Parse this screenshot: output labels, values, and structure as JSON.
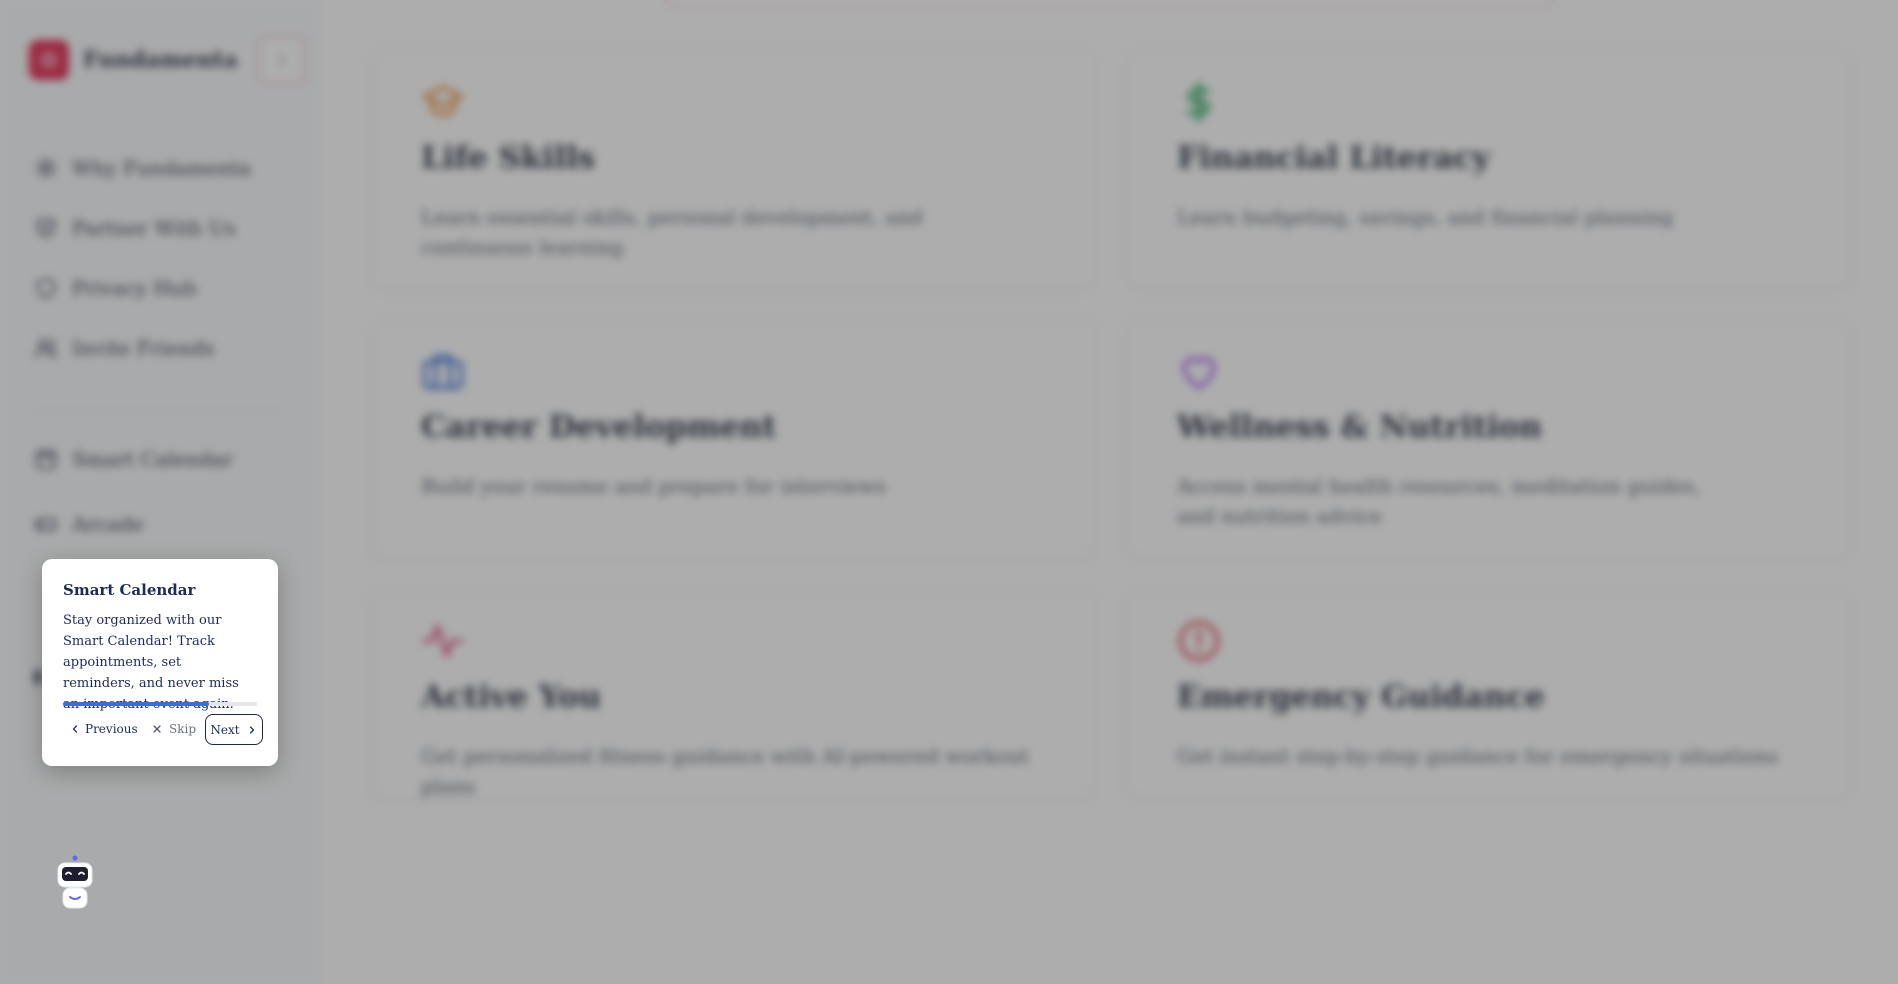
{
  "app": {
    "name": "Fundamenta",
    "brand_color": "#e11d48"
  },
  "sidebar": {
    "collapse_icon": "chevron-left-icon",
    "items": [
      {
        "label": "Why Fundamenta",
        "icon": "sparkle-cog-icon"
      },
      {
        "label": "Partner With Us",
        "icon": "handshake-shield-icon"
      },
      {
        "label": "Privacy Hub",
        "icon": "shield-icon"
      },
      {
        "label": "Invite Friends",
        "icon": "users-icon"
      },
      {
        "label": "Smart Calendar",
        "icon": "calendar-icon"
      },
      {
        "label": "Arcade",
        "icon": "gamepad-icon"
      }
    ]
  },
  "cards": [
    {
      "title": "Life Skills",
      "description": "Learn essential skills, personal development, and continuous learning",
      "icon": "graduation-cap-icon",
      "color": "#ea8a2e"
    },
    {
      "title": "Financial Literacy",
      "description": "Learn budgeting, savings, and financial planning",
      "icon": "dollar-icon",
      "color": "#22a55a"
    },
    {
      "title": "Career Development",
      "description": "Build your resume and prepare for interviews",
      "icon": "briefcase-icon",
      "color": "#3b6fd8"
    },
    {
      "title": "Wellness & Nutrition",
      "description": "Access mental health resources, meditation guides, and nutrition advice",
      "icon": "heart-icon",
      "color": "#a855f7"
    },
    {
      "title": "Active You",
      "description": "Get personalized fitness guidance with AI-powered workout plans",
      "icon": "activity-icon",
      "color": "#e0457b"
    },
    {
      "title": "Emergency Guidance",
      "description": "Get instant step-by-step guidance for emergency situations",
      "icon": "alert-circle-icon",
      "color": "#e23b4a"
    }
  ],
  "tour": {
    "title": "Smart Calendar",
    "body": "Stay organized with our Smart Calendar! Track appointments, set reminders, and never miss an important event again.",
    "progress": 0.75,
    "previous_label": "Previous",
    "skip_label": "Skip",
    "next_label": "Next"
  },
  "assistant": {
    "icon": "robot-assistant-icon"
  }
}
